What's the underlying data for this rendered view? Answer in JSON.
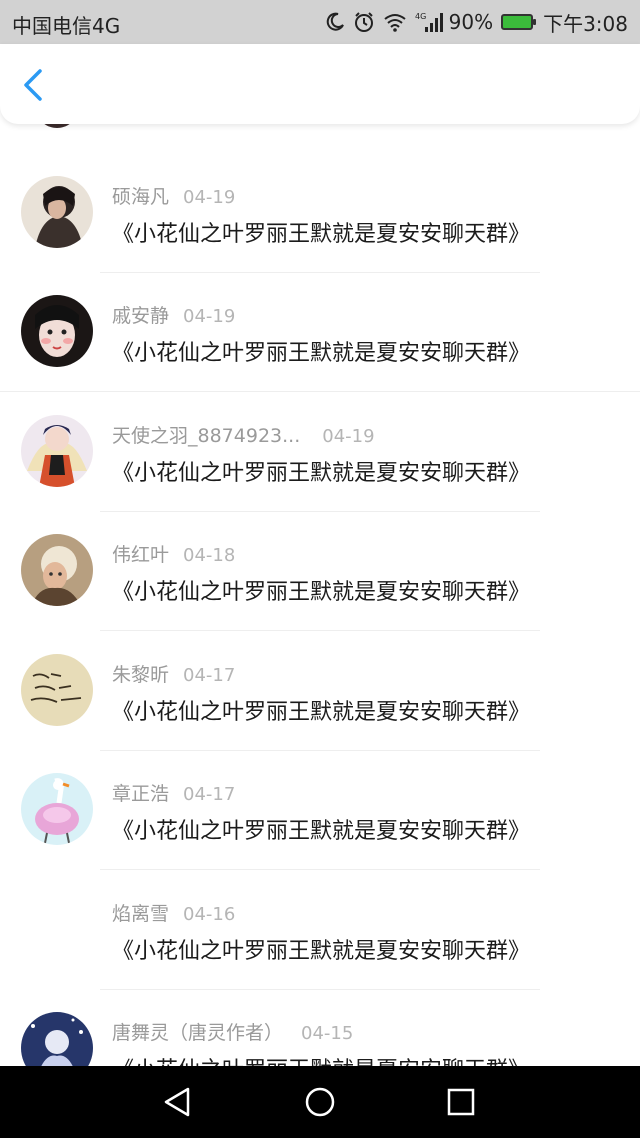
{
  "status_bar": {
    "carrier": "中国电信4G",
    "network_badge": "4G",
    "battery": "90%",
    "time": "下午3:08",
    "icons": [
      "moon-icon",
      "alarm-icon",
      "wifi-icon",
      "signal-icon",
      "battery-icon"
    ],
    "battery_color": "#3bbb3b"
  },
  "header": {
    "back_icon": "back-chevron-icon",
    "accent": "#2b9af3"
  },
  "messages": [
    {
      "name": "硕海凡",
      "date": "04-19",
      "text": "《小花仙之叶罗丽王默就是夏安安聊天群》",
      "avatar": "avatar-1"
    },
    {
      "name": "戚安静",
      "date": "04-19",
      "text": "《小花仙之叶罗丽王默就是夏安安聊天群》",
      "avatar": "avatar-2"
    },
    {
      "name": "天使之羽_8874923...",
      "date": "04-19",
      "text": "《小花仙之叶罗丽王默就是夏安安聊天群》",
      "avatar": "avatar-3"
    },
    {
      "name": "伟红叶",
      "date": "04-18",
      "text": "《小花仙之叶罗丽王默就是夏安安聊天群》",
      "avatar": "avatar-4"
    },
    {
      "name": "朱黎昕",
      "date": "04-17",
      "text": "《小花仙之叶罗丽王默就是夏安安聊天群》",
      "avatar": "avatar-5"
    },
    {
      "name": "章正浩",
      "date": "04-17",
      "text": "《小花仙之叶罗丽王默就是夏安安聊天群》",
      "avatar": "avatar-6"
    },
    {
      "name": "焰离雪",
      "date": "04-16",
      "text": "《小花仙之叶罗丽王默就是夏安安聊天群》",
      "avatar": ""
    },
    {
      "name": "唐舞灵（唐灵作者）",
      "date": "04-15",
      "text": "《小花仙之叶罗丽王默就是夏安安聊天群》",
      "avatar": "avatar-8"
    }
  ],
  "nav_bar": {
    "icons": [
      "nav-back-icon",
      "nav-home-icon",
      "nav-recent-icon"
    ]
  }
}
